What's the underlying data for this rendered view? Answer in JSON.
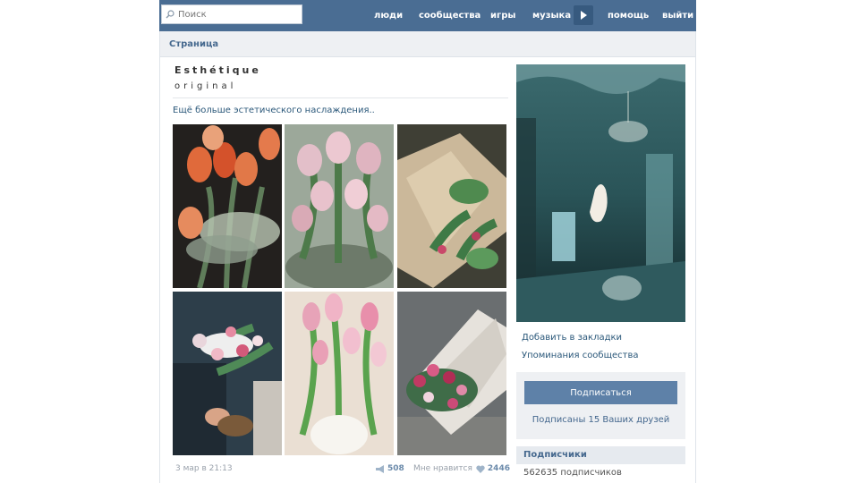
{
  "search": {
    "placeholder": "Поиск"
  },
  "nav": {
    "people": "люди",
    "communities": "сообщества",
    "games": "игры",
    "music": "музыка",
    "help": "помощь",
    "logout": "выйти"
  },
  "page": {
    "breadcrumb": "Страница"
  },
  "post": {
    "title": "Esthétique",
    "subtitle": "original",
    "text": "Ещё больше эстетического наслаждения..",
    "date": "3 мар в 21:13",
    "reposts": "508",
    "like_label": "Мне нравится",
    "likes": "2446"
  },
  "sidebar": {
    "bookmark_link": "Добавить в закладки",
    "mentions_link": "Упоминания сообщества",
    "subscribe_button": "Подписаться",
    "friends_text": "Подписаны 15 Ваших друзей",
    "subscribers_title": "Подписчики",
    "subscribers_count": "562635 подписчиков"
  },
  "colors": {
    "header": "#4a6d93",
    "accent": "#5e81a8",
    "link": "#2b587a"
  }
}
